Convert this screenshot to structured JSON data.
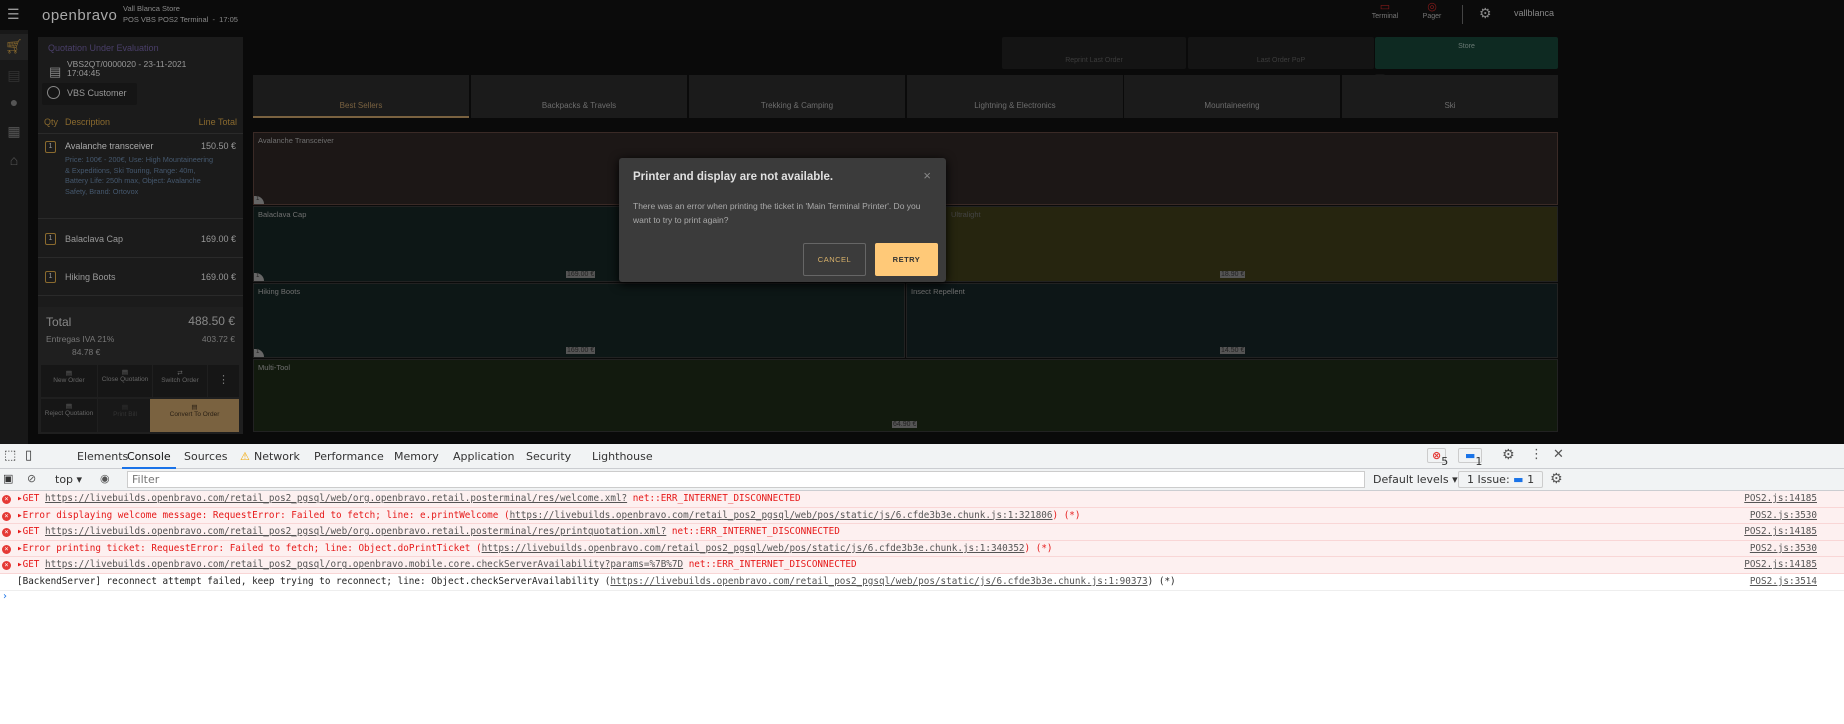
{
  "header": {
    "logo": "openbravo",
    "store": "Vall Blanca Store",
    "terminal": "POS VBS POS2 Terminal  -  17:05",
    "terminal_btn": "Terminal",
    "pager_btn": "Pager",
    "user": "vallblanca"
  },
  "order": {
    "status": "Quotation Under Evaluation",
    "doc": "VBS2QT/0000020 - 23-11-2021 17:04:45",
    "customer": "VBS Customer",
    "col_qty": "Qty",
    "col_desc": "Description",
    "col_total": "Line Total",
    "lines": [
      {
        "qty": "1",
        "name": "Avalanche transceiver",
        "total": "150.50 €",
        "attrs": "Price: 100€ - 200€, Use: High Mountaineering & Expeditions, Ski Touring, Range: 40m, Battery Life: 250h max, Object: Avalanche Safety, Brand: Ortovox"
      },
      {
        "qty": "1",
        "name": "Balaclava Cap",
        "total": "169.00 €"
      },
      {
        "qty": "1",
        "name": "Hiking Boots",
        "total": "169.00 €"
      }
    ],
    "total_label": "Total",
    "total": "488.50 €",
    "tax_label": "Entregas IVA 21%",
    "tax_base": "403.72 €",
    "tax_amount": "84.78 €"
  },
  "actions": {
    "new_order": "New Order",
    "close_quotation": "Close Quotation",
    "switch_order": "Switch Order",
    "more": "⋮",
    "reject_quotation": "Reject Quotation",
    "print_bill": "Print Bill",
    "convert": "Convert To Order"
  },
  "toolbar": {
    "reprint": "Reprint Last Order",
    "last_pop": "Last Order PoP",
    "store": "Store"
  },
  "categories": [
    "Best Sellers",
    "Backpacks & Travels",
    "Trekking & Camping",
    "Lightning & Electronics",
    "Mountaineering",
    "Ski"
  ],
  "products": [
    {
      "name": "Avalanche Transceiver",
      "badge": "1"
    },
    {
      "name": "Balaclava Cap",
      "price": "169.00 €",
      "badge": "1"
    },
    {
      "name": "Ultralight",
      "price": "18.90 €"
    },
    {
      "name": "Hiking Boots",
      "price": "169.00 €",
      "badge": "1"
    },
    {
      "name": "Insect Repellent",
      "price": "14.50 €"
    },
    {
      "name": "Multi-Tool",
      "price": "64.90 €"
    }
  ],
  "dialog": {
    "title": "Printer and display are not available.",
    "body": "There was an error when printing the ticket in 'Main Terminal Printer'. Do you want to try to print again?",
    "cancel": "CANCEL",
    "retry": "RETRY"
  },
  "devtools": {
    "tabs": [
      "Elements",
      "Console",
      "Sources",
      "Network",
      "Performance",
      "Memory",
      "Application",
      "Security",
      "Lighthouse"
    ],
    "errors": "5",
    "messages": "1",
    "context": "top",
    "filter_placeholder": "Filter",
    "levels": "Default levels",
    "issues": "1 Issue:",
    "issues_count": "1",
    "rows": [
      {
        "pre": "GET ",
        "url": "https://livebuilds.openbravo.com/retail_pos2_pgsql/web/org.openbravo.retail.posterminal/res/welcome.xml?",
        "post": " net::ERR_INTERNET_DISCONNECTED",
        "src": "POS2.js:14185"
      },
      {
        "pre": "Error displaying welcome message: RequestError: Failed to fetch; line: e.printWelcome (",
        "url": "https://livebuilds.openbravo.com/retail_pos2_pgsql/web/pos/static/js/6.cfde3b3e.chunk.js:1:321806",
        "post": ") (*)",
        "src": "POS2.js:3530"
      },
      {
        "pre": "GET ",
        "url": "https://livebuilds.openbravo.com/retail_pos2_pgsql/web/org.openbravo.retail.posterminal/res/printquotation.xml?",
        "post": " net::ERR_INTERNET_DISCONNECTED",
        "src": "POS2.js:14185"
      },
      {
        "pre": "Error printing ticket: RequestError: Failed to fetch; line: Object.doPrintTicket (",
        "url": "https://livebuilds.openbravo.com/retail_pos2_pgsql/web/pos/static/js/6.cfde3b3e.chunk.js:1:340352",
        "post": ") (*)",
        "src": "POS2.js:3530"
      },
      {
        "pre": "GET ",
        "url": "https://livebuilds.openbravo.com/retail_pos2_pgsql/org.openbravo.mobile.core.checkServerAvailability?params=%7B%7D",
        "post": " net::ERR_INTERNET_DISCONNECTED",
        "src": "POS2.js:14185"
      },
      {
        "pre": "[BackendServer] reconnect attempt failed, keep trying to reconnect; line: Object.checkServerAvailability (",
        "url": "https://livebuilds.openbravo.com/retail_pos2_pgsql/web/pos/static/js/6.cfde3b3e.chunk.js:1:90373",
        "post": ") (*)",
        "src": "POS2.js:3514"
      }
    ]
  }
}
